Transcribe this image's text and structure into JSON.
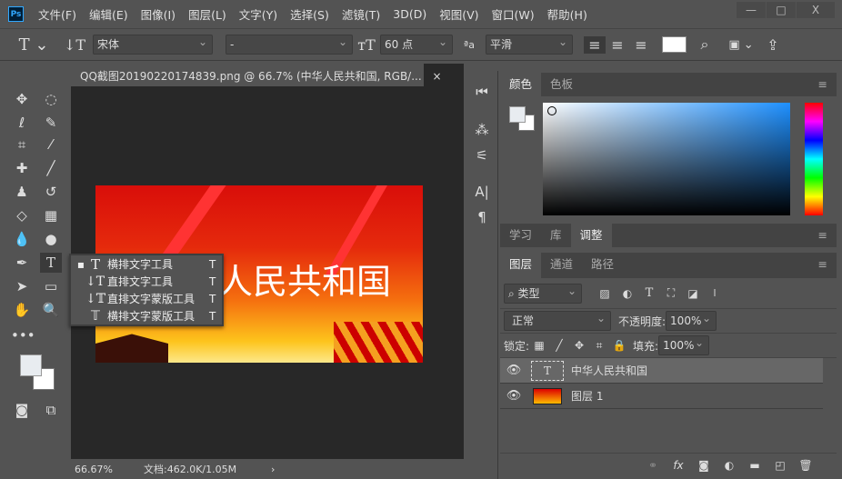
{
  "app": {
    "logo": "Ps",
    "menu": [
      "文件(F)",
      "编辑(E)",
      "图像(I)",
      "图层(L)",
      "文字(Y)",
      "选择(S)",
      "滤镜(T)",
      "3D(D)",
      "视图(V)",
      "窗口(W)",
      "帮助(H)"
    ],
    "window_buttons": [
      "—",
      "□",
      "X"
    ]
  },
  "options": {
    "font_family": "宋体",
    "font_style": "-",
    "font_size": "60 点",
    "antialias": "平滑",
    "text_color": "#ffffff"
  },
  "document": {
    "tab_title": "QQ截图20190220174839.png @ 66.7% (中华人民共和国, RGB/...",
    "close": "×",
    "canvas_text": "人民共和国",
    "zoom": "66.67%",
    "doc_info": "文档:462.0K/1.05M",
    "arrow": "›"
  },
  "flyout": {
    "items": [
      {
        "label": "横排文字工具",
        "shortcut": "T",
        "active": true
      },
      {
        "label": "直排文字工具",
        "shortcut": "T"
      },
      {
        "label": "直排文字蒙版工具",
        "shortcut": "T"
      },
      {
        "label": "横排文字蒙版工具",
        "shortcut": "T"
      }
    ]
  },
  "color_panel": {
    "tabs": [
      "颜色",
      "色板"
    ],
    "foreground": "#e8ecf0",
    "background": "#ffffff",
    "hue": "#1e90ff"
  },
  "mid_panel": {
    "tabs": [
      "学习",
      "库",
      "调整"
    ]
  },
  "layers_panel": {
    "tabs": [
      "图层",
      "通道",
      "路径"
    ],
    "filter": "类型",
    "blend": "正常",
    "opacity_label": "不透明度:",
    "opacity": "100%",
    "lock_label": "锁定:",
    "fill_label": "填充:",
    "fill": "100%",
    "layers": [
      {
        "name": "中华人民共和国",
        "type": "text",
        "selected": true
      },
      {
        "name": "图层 1",
        "type": "image"
      }
    ]
  }
}
